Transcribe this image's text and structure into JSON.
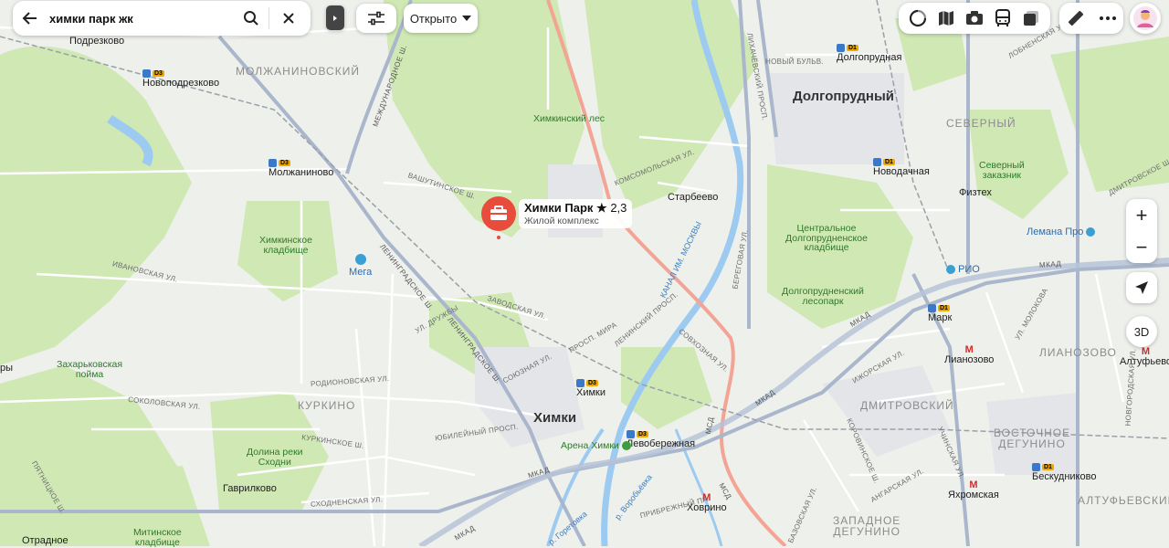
{
  "search": {
    "query": "химки парк жк",
    "filter_label": "Открыто"
  },
  "place_card": {
    "title": "Химки Парк",
    "rating": "2,3",
    "subtitle": "Жилой комплекс"
  },
  "zoom": {
    "plus": "+",
    "minus": "−",
    "mode_3d": "3D"
  },
  "cities": {
    "khimki": "Химки",
    "dolgoprudny": "Долгопрудный"
  },
  "districts": {
    "molzhaninovsky": "МОЛЖАНИНОВСКИЙ",
    "kurkino": "КУРКИНО",
    "dmitrovsky": "ДМИТРОВСКИЙ",
    "severny": "СЕВЕРНЫЙ",
    "lianozovo": "ЛИАНОЗОВО",
    "vost_degunino": "ВОСТОЧНОЕ\nДЕГУНИНО",
    "zap_degunino": "ЗАПАДНОЕ\nДЕГУНИНО",
    "altufevsky": "АЛТУФЬЕВСКИЙ"
  },
  "places": {
    "podrezkovo": "Подрезково",
    "novopodrezkovo": "Новоподрезково",
    "molzhaninovo": "Молжаниново",
    "starbeevo": "Старбеево",
    "gavrilkovo": "Гаврилково",
    "otradnoe": "Отрадное",
    "khovrino": "Ховрино",
    "levoberezhnaya": "Левобережная",
    "khimki_st": "Химки",
    "dolgoprudnaya": "Долгопрудная",
    "novodachnaya": "Новодачная",
    "fiztekh": "Физтех",
    "mark": "Марк",
    "lianozovo_st": "Лианозово",
    "beskudnikovo": "Бескудниково",
    "yakhromskaya": "Яхромская",
    "altufevo": "Алтуфьево",
    "mega": "Мега",
    "arena": "Арена Химки",
    "rio": "РИО",
    "lemana": "Лемана Про",
    "ry": "ры"
  },
  "greens": {
    "khimki_les": "Химкинский лес",
    "khimki_cemetery": "Химкинское\nкладбище",
    "zakharkovskaya": "Захарьковская\nпойма",
    "dolina": "Долина реки\nСходни",
    "mitinskoe": "Митинское\nкладбище",
    "central_dolg": "Центральное\nДолгопрудненское\nкладбище",
    "dolg_lesopark": "Долгопрудненский\nлесопарк",
    "severny_zakaznik": "Северный\nзаказник"
  },
  "streets": {
    "mkad": "МКАД",
    "msd": "МСД",
    "leningradskoe": "ЛЕНИНГРАДСКОЕ Ш.",
    "mezhdunarodnoe": "МЕЖДУНАРОДНОЕ Ш.",
    "vashutinskoe": "ВАШУТИНСКОЕ Ш.",
    "komsomolskaya": "КОМСОМОЛЬСКАЯ УЛ.",
    "zavodskaya": "ЗАВОДСКАЯ УЛ.",
    "sovkhoznaya": "СОВХОЗНАЯ УЛ.",
    "likhachevsky": "ЛИХАЧЁВСКИЙ ПРОСП.",
    "sokolovskaya": "СОКОЛОВСКАЯ УЛ.",
    "rodionovskaya": "РОДИОНОВСКАЯ УЛ.",
    "kurkinskoe": "КУРКИНСКОЕ Ш.",
    "skhodnenskaya": "СХОДНЕНСКАЯ УЛ.",
    "ivanovskaya": "ИВАНОВСКАЯ УЛ.",
    "izhorskaya": "ИЖОРСКАЯ УЛ.",
    "korovinskoe": "КОРОВИНСКОЕ Ш.",
    "angarskaya": "АНГАРСКАЯ УЛ.",
    "pyatnitskoe": "ПЯТНИЦКОЕ Ш.",
    "lobnenskaya": "ЛОБНЕНСКАЯ УЛ.",
    "dmitrovskoe": "ДМИТРОВСКОЕ Ш.",
    "soyuznaya": "СОЮЗНАЯ УЛ.",
    "leninsky": "ЛЕНИНСКИЙ ПРОСП.",
    "yubileyny": "ЮБИЛЕЙНЫЙ ПРОСП.",
    "kanal": "КАНАЛ ИМ. МОСКВЫ",
    "river_vorobyovka": "р. Воробьёвка",
    "river_goroshka": "р. Горетовка",
    "novy_bulvar": "НОВЫЙ БУЛЬВ.",
    "pr_mira": "ПРОСП. МИРА",
    "pr_druzhby": "УЛ. ДРУЖБЫ",
    "berezhkovaya": "БЕРЕГОВАЯ УЛ.",
    "molokova": "УЛ. МОЛОКОВА",
    "novgorodskaya": "НОВГОРОДСКАЯ УЛ.",
    "uchinskaya": "УЧИНСКАЯ УЛ.",
    "bazovskaya": "БАЗОВСКАЯ УЛ.",
    "pribrezhny": "ПРИБРЕЖНЫЙ ПР."
  },
  "colors": {
    "map_bg": "#eef0ec",
    "forest": "#cfe8b4",
    "water": "#9ccaf0",
    "highway": "#f3a495",
    "ring_road": "#a9b6cb",
    "pin": "#e74c3c",
    "accent_blue": "#3a78c9"
  },
  "icons": {
    "back": "arrow-left-icon",
    "search": "search-icon",
    "clear": "close-icon",
    "filters": "sliders-icon",
    "dropdown": "chevron-down-icon",
    "traffic": "traffic-icon",
    "layers": "layers-icon",
    "camera": "camera-icon",
    "transit": "bus-icon",
    "panorama": "panorama-icon",
    "ruler": "ruler-icon",
    "more": "more-icon",
    "avatar": "avatar-icon",
    "locate": "locate-arrow-icon"
  }
}
